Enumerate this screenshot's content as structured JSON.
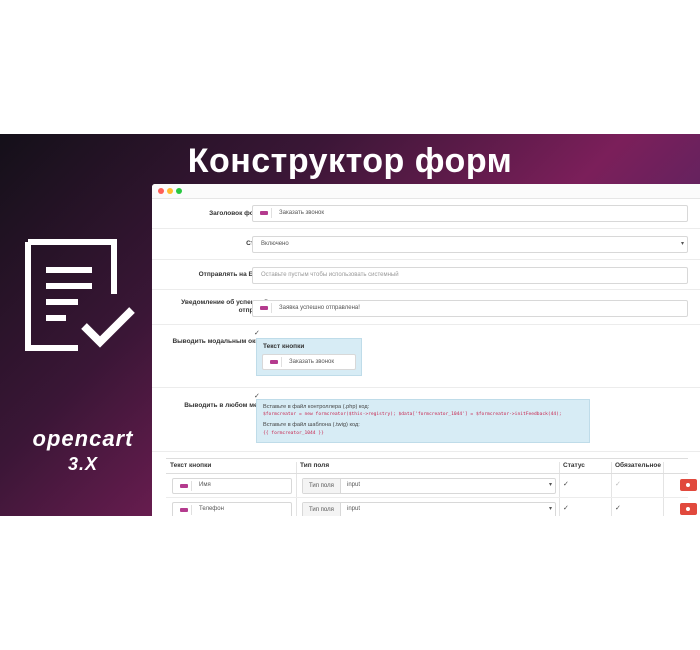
{
  "banner": {
    "title": "Конструктор форм",
    "brand_name": "opencart",
    "brand_version": "3.X"
  },
  "form": {
    "fields": [
      {
        "label": "Заголовок формы",
        "value": "Заказать звонок"
      },
      {
        "label": "Статус",
        "value": "Включено"
      },
      {
        "label": "Отправлять на E-mail",
        "placeholder": "Оставьте пустым чтобы использовать системный"
      },
      {
        "label": "Уведомление об успешной отправке",
        "value": "Заявка успешно отправлена!"
      }
    ],
    "modal": {
      "label": "Выводить модальным окном",
      "checkbox": "✓",
      "button_text_label": "Текст кнопки",
      "button_text_value": "Заказать звонок"
    },
    "anywhere": {
      "label": "Выводить в любом месте",
      "checkbox": "✓",
      "controller_hint": "Вставьте в файл контроллера (.php) код:",
      "controller_code": "$formcreator = new formcreator($this->registry); $data['formcreator_1044'] = $formcreator->initFeedback(44);",
      "template_hint": "Вставьте в файл шаблона (.twig) код:",
      "template_code": "{{ formcreator_1044 }}"
    }
  },
  "table": {
    "headers": [
      "Текст кнопки",
      "Тип поля",
      "Статус",
      "Обязательное"
    ],
    "rows": [
      {
        "name": "Имя",
        "type_tag": "Тип поля",
        "type_value": "input",
        "status": "✓",
        "required": "✓",
        "required_on": false
      },
      {
        "name": "Телефон",
        "type_tag": "Тип поля",
        "type_value": "input",
        "status": "✓",
        "required": "✓",
        "required_on": true
      }
    ]
  },
  "icons": {
    "caret": "▾"
  }
}
